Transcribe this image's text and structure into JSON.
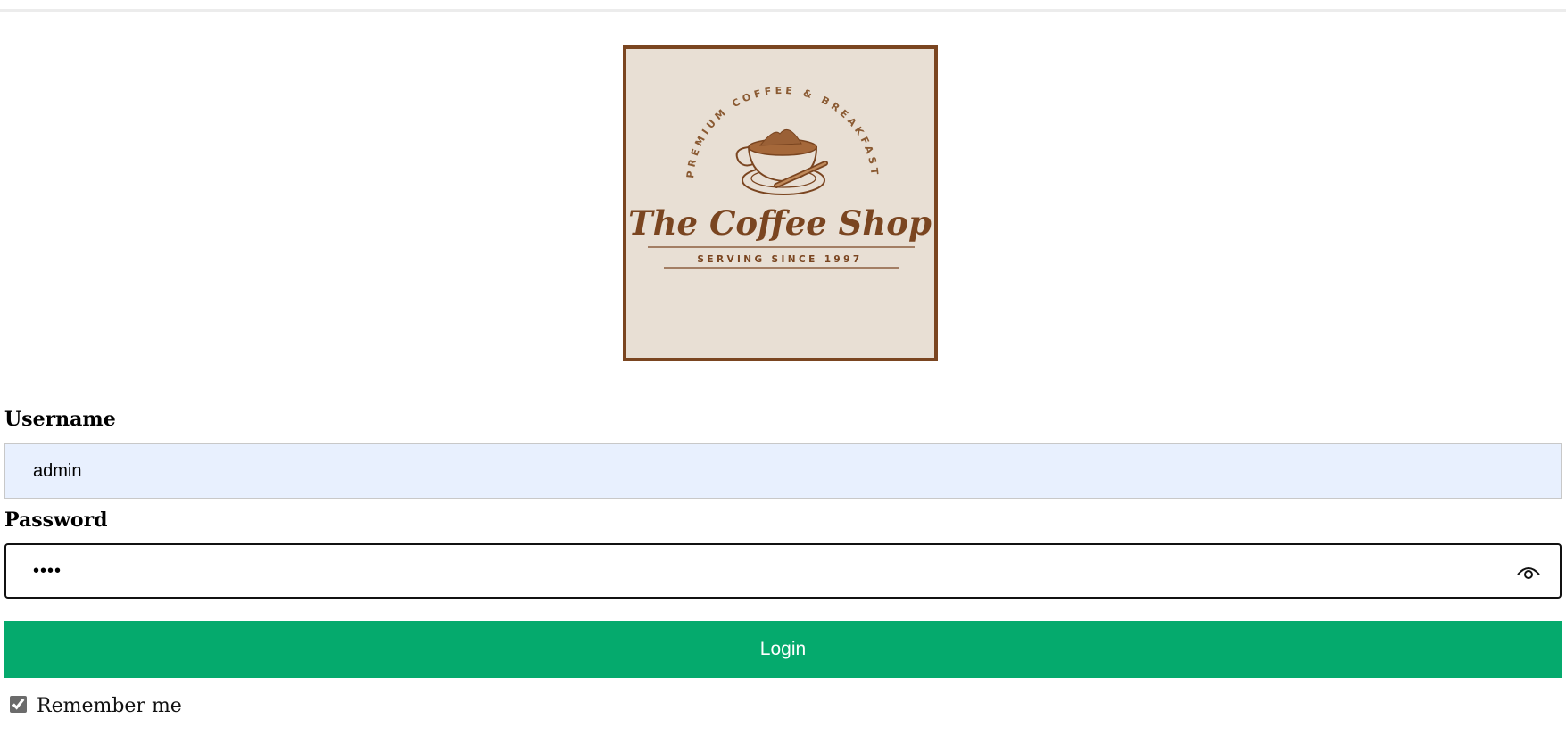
{
  "logo": {
    "arc_text": "PREMIUM COFFEE & BREAKFAST",
    "brand_name": "The Coffee Shop",
    "tagline": "SERVING SINCE 1997"
  },
  "form": {
    "username_label": "Username",
    "username_value": "admin",
    "password_label": "Password",
    "password_value": "1234",
    "login_label": "Login",
    "remember_label": "Remember me",
    "remember_checked": true
  },
  "colors": {
    "accent": "#05aa6d",
    "logo_brown": "#7a4520",
    "logo_bg": "#e8dfd4",
    "autofill_bg": "#e8f0fe"
  },
  "icons": {
    "password_toggle": "eye-icon"
  }
}
